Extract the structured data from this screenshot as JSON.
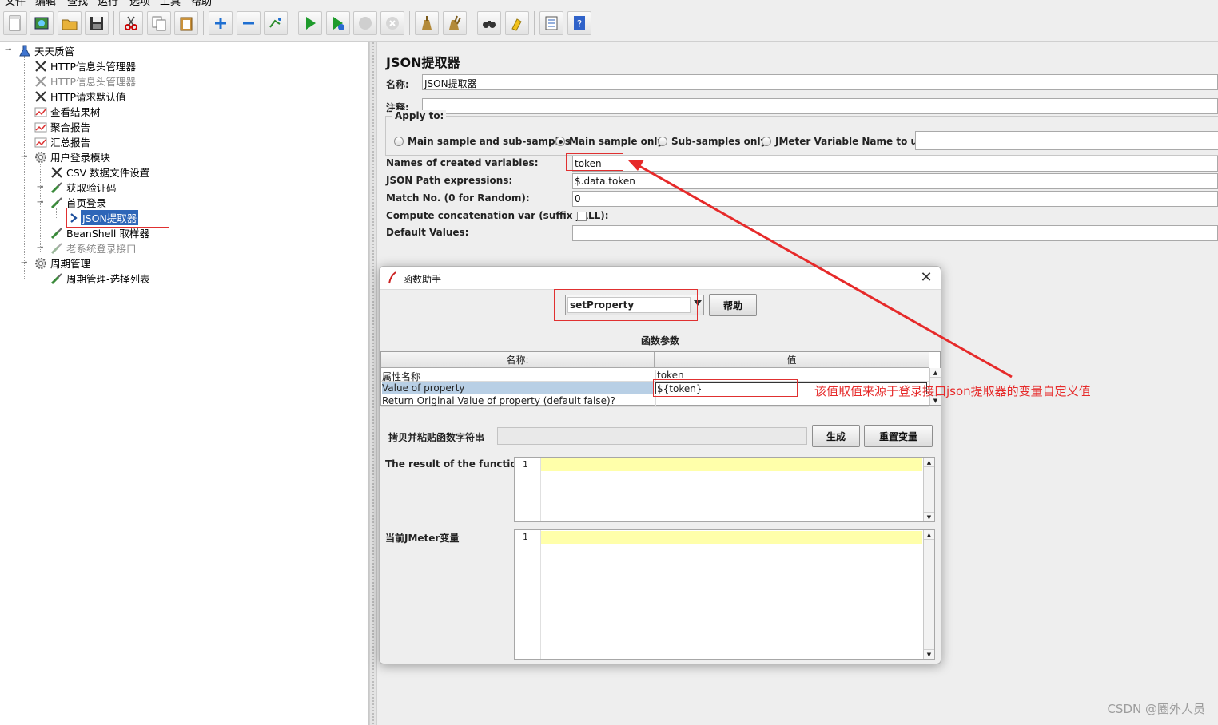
{
  "menubar": [
    "文件",
    "编辑",
    "查找",
    "运行",
    "选项",
    "工具",
    "帮助"
  ],
  "toolbar": [
    {
      "icon": "new-icon"
    },
    {
      "icon": "templates-icon"
    },
    {
      "icon": "open-icon"
    },
    {
      "icon": "save-icon"
    },
    {
      "icon": "cut-icon"
    },
    {
      "icon": "copy-icon"
    },
    {
      "icon": "paste-icon"
    },
    {
      "icon": "expand-icon"
    },
    {
      "icon": "collapse-icon"
    },
    {
      "icon": "toggle-icon"
    },
    {
      "icon": "start-icon"
    },
    {
      "icon": "start-no-pause-icon"
    },
    {
      "icon": "stop-icon"
    },
    {
      "icon": "shutdown-icon"
    },
    {
      "icon": "clear-icon"
    },
    {
      "icon": "clear-all-icon"
    },
    {
      "icon": "search-icon"
    },
    {
      "icon": "reset-search-icon"
    },
    {
      "icon": "function-helper-icon"
    },
    {
      "icon": "help-icon"
    }
  ],
  "tree": [
    {
      "label": "天天质管",
      "icon": "test-plan-icon"
    },
    {
      "label": "HTTP信息头管理器",
      "icon": "config-icon"
    },
    {
      "label": "HTTP信息头管理器",
      "icon": "config-icon",
      "disabled": true
    },
    {
      "label": "HTTP请求默认值",
      "icon": "config-icon"
    },
    {
      "label": "查看结果树",
      "icon": "listener-icon"
    },
    {
      "label": "聚合报告",
      "icon": "listener-icon"
    },
    {
      "label": "汇总报告",
      "icon": "listener-icon"
    },
    {
      "label": "用户登录模块",
      "icon": "thread-group-icon"
    },
    {
      "label": "CSV 数据文件设置",
      "icon": "config-icon"
    },
    {
      "label": "获取验证码",
      "icon": "sampler-icon"
    },
    {
      "label": "首页登录",
      "icon": "sampler-icon"
    },
    {
      "label": "JSON提取器",
      "icon": "extractor-icon",
      "selected": true
    },
    {
      "label": "BeanShell 取样器",
      "icon": "sampler-icon"
    },
    {
      "label": "老系统登录接口",
      "icon": "sampler-icon",
      "disabled": true
    },
    {
      "label": "周期管理",
      "icon": "thread-group-icon"
    },
    {
      "label": "周期管理-选择列表",
      "icon": "sampler-icon"
    }
  ],
  "editor": {
    "title": "JSON提取器",
    "name_label": "名称:",
    "name_value": "JSON提取器",
    "comment_label": "注释:",
    "comment_value": "",
    "apply_to": "Apply to:",
    "radios": [
      {
        "label": "Main sample and sub-samples",
        "checked": false
      },
      {
        "label": "Main sample only",
        "checked": true
      },
      {
        "label": "Sub-samples only",
        "checked": false
      },
      {
        "label": "JMeter Variable Name to use",
        "checked": false
      }
    ],
    "jmeter_var_value": "",
    "var_names_label": "Names of created variables:",
    "var_names_value": "token",
    "json_path_label": "JSON Path expressions:",
    "json_path_value": "$.data.token",
    "match_no_label": "Match No. (0 for Random):",
    "match_no_value": "0",
    "concat_label": "Compute concatenation var (suffix _ALL):",
    "concat_checked": false,
    "default_label": "Default Values:",
    "default_value": ""
  },
  "dialog": {
    "title": "函数助手",
    "function_selected": "setProperty",
    "help_button": "帮助",
    "params_title": "函数参数",
    "columns": [
      "名称:",
      "值"
    ],
    "rows": [
      {
        "name": "属性名称",
        "value": "token"
      },
      {
        "name": "Value of property",
        "value": "${token}",
        "selected": true
      },
      {
        "name": "Return Original Value of property (default false)?",
        "value": ""
      }
    ],
    "copy_label": "拷贝并粘贴函数字符串",
    "copy_value": "",
    "generate_button": "生成",
    "reset_button": "重置变量",
    "result_label": "The result of the function is",
    "result_line": "1",
    "vars_label": "当前JMeter变量",
    "vars_line": "1"
  },
  "annotation": {
    "text": "该值取值来源于登录接口json提取器的变量自定义值",
    "color": "#e62a2a"
  },
  "watermark": "CSDN @圈外人员"
}
